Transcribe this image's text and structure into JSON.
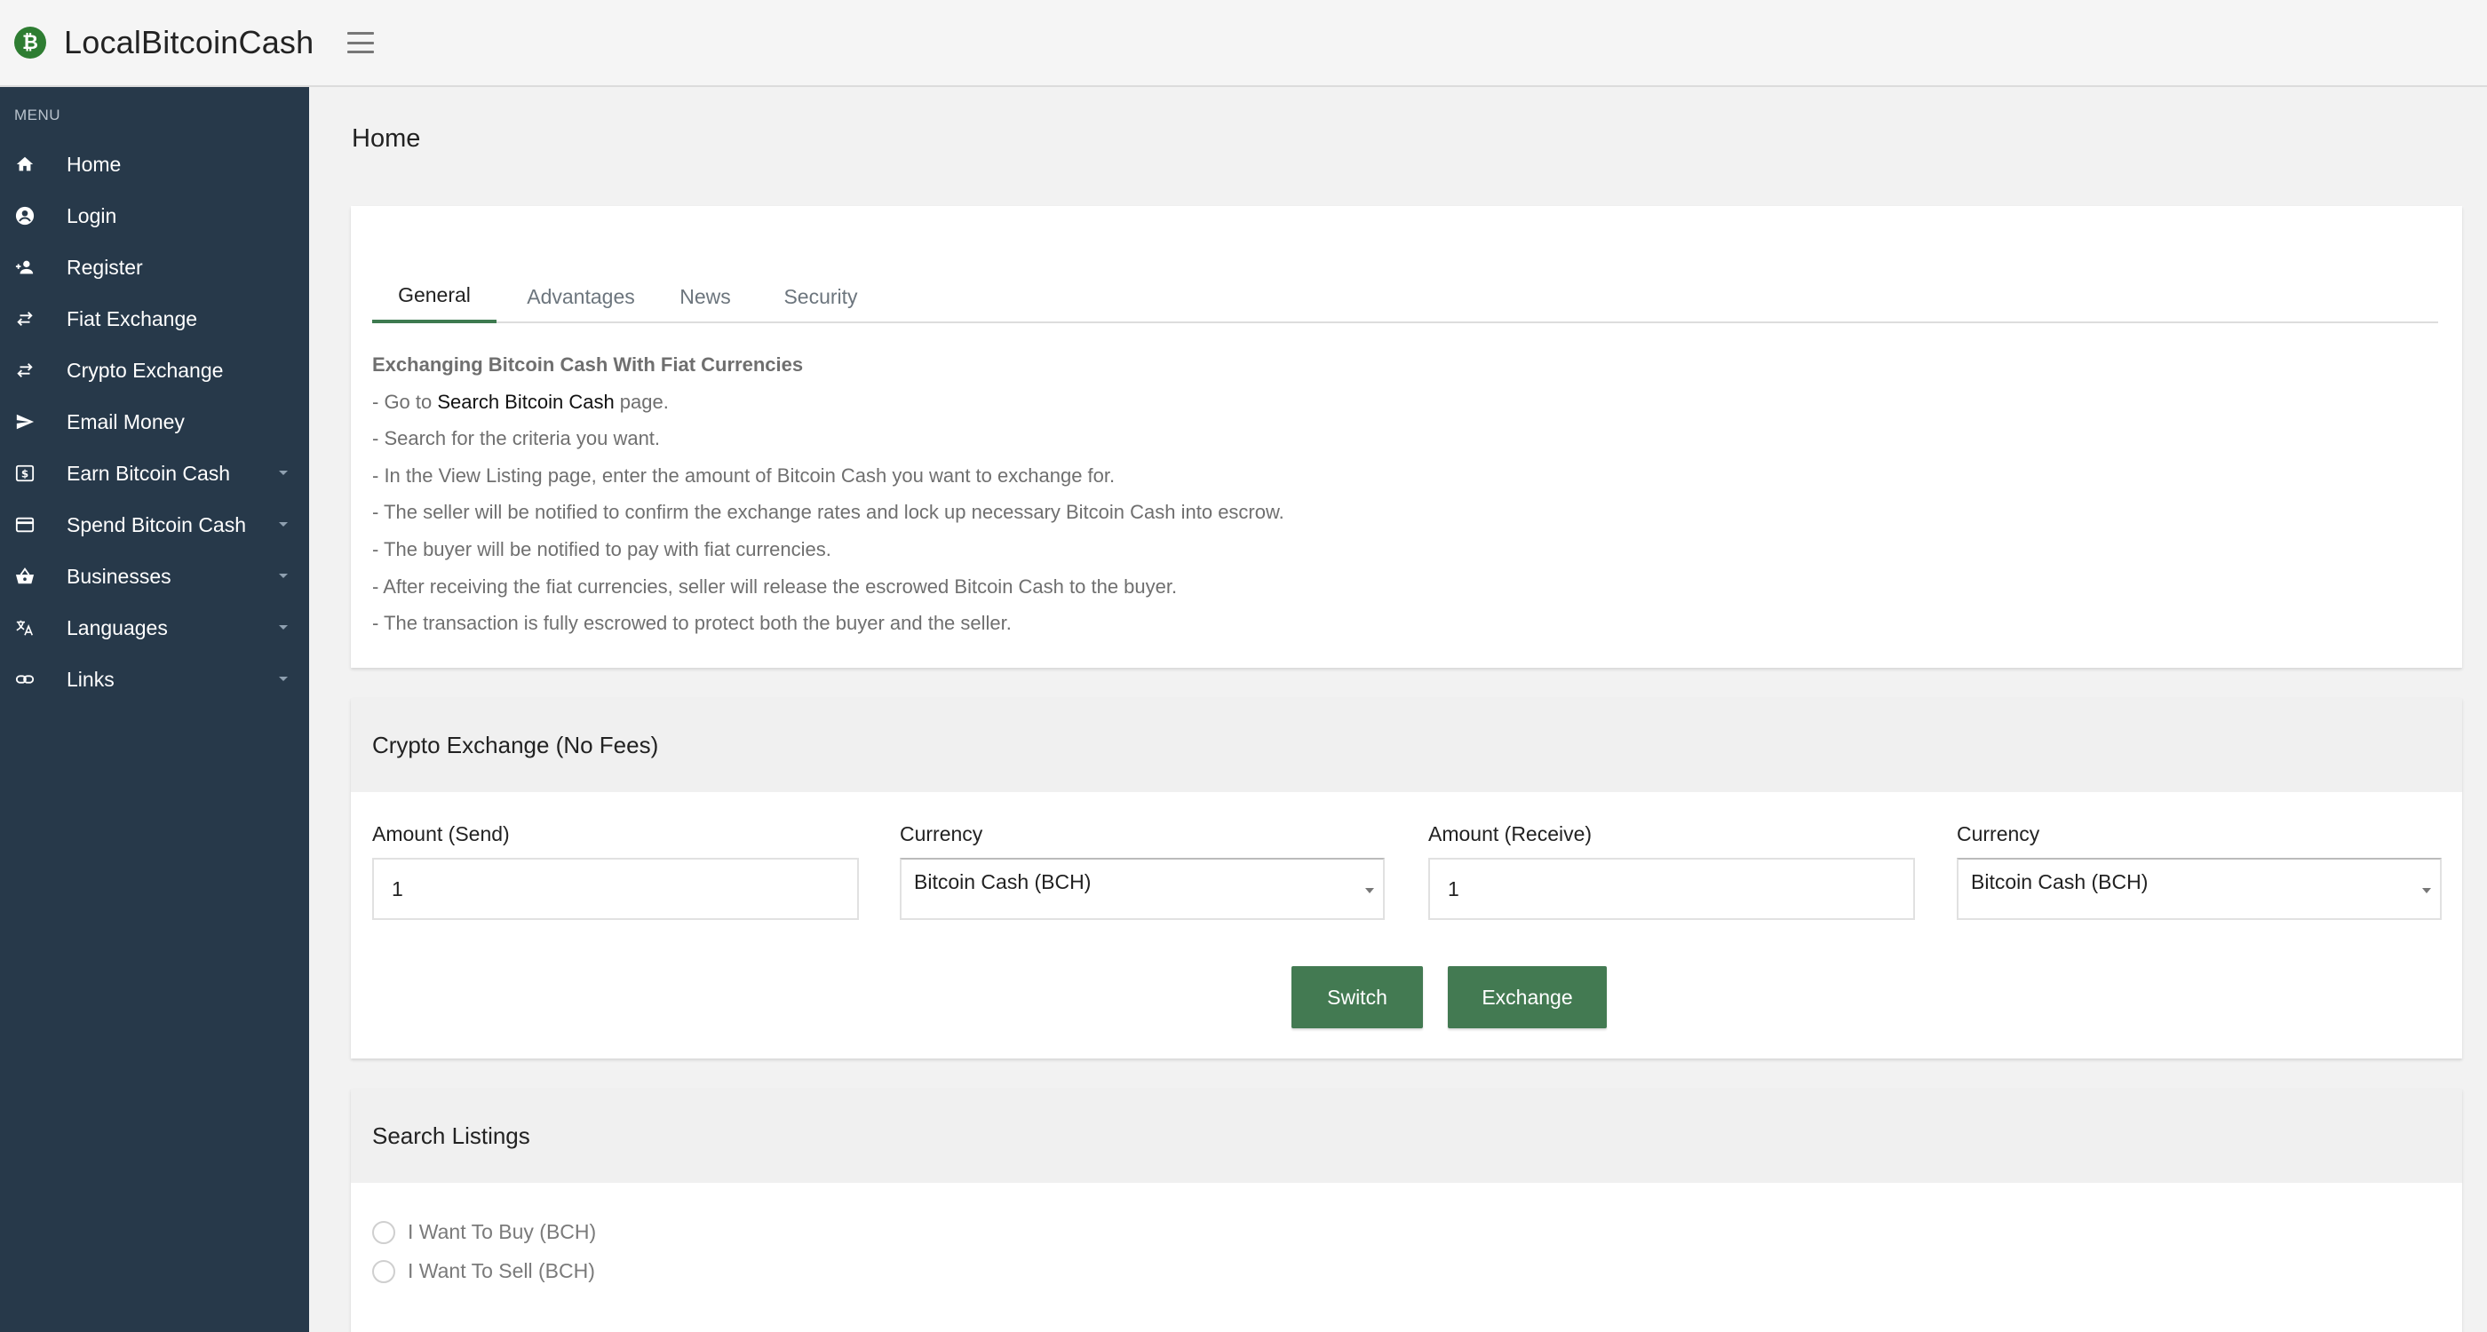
{
  "header": {
    "logo_glyph": "₿",
    "brand": "LocalBitcoinCash",
    "menu_icon": "hamburger-icon"
  },
  "sidebar": {
    "menu_header": "MENU",
    "items": [
      {
        "label": "Home",
        "icon": "home-icon",
        "has_submenu": false
      },
      {
        "label": "Login",
        "icon": "user-circle-icon",
        "has_submenu": false
      },
      {
        "label": "Register",
        "icon": "person-add-icon",
        "has_submenu": false
      },
      {
        "label": "Fiat Exchange",
        "icon": "swap-icon",
        "has_submenu": false
      },
      {
        "label": "Crypto Exchange",
        "icon": "swap-icon",
        "has_submenu": false
      },
      {
        "label": "Email Money",
        "icon": "send-icon",
        "has_submenu": false
      },
      {
        "label": "Earn Bitcoin Cash",
        "icon": "dollar-box-icon",
        "has_submenu": true
      },
      {
        "label": "Spend Bitcoin Cash",
        "icon": "credit-card-icon",
        "has_submenu": true
      },
      {
        "label": "Businesses",
        "icon": "basket-icon",
        "has_submenu": true
      },
      {
        "label": "Languages",
        "icon": "translate-icon",
        "has_submenu": true
      },
      {
        "label": "Links",
        "icon": "link-icon",
        "has_submenu": true
      }
    ]
  },
  "main": {
    "page_title": "Home",
    "tabs": [
      {
        "label": "General",
        "active": true
      },
      {
        "label": "Advantages",
        "active": false
      },
      {
        "label": "News",
        "active": false
      },
      {
        "label": "Security",
        "active": false
      }
    ],
    "general": {
      "heading": "Exchanging Bitcoin Cash With Fiat Currencies",
      "line1_prefix": "- Go to ",
      "line1_link": "Search Bitcoin Cash",
      "line1_suffix": " page.",
      "line2": "- Search for the criteria you want.",
      "line3": "- In the View Listing page, enter the amount of Bitcoin Cash you want to exchange for.",
      "line4": "- The seller will be notified to confirm the exchange rates and lock up necessary Bitcoin Cash into escrow.",
      "line5": "- The buyer will be notified to pay with fiat currencies.",
      "line6": "- After receiving the fiat currencies, seller will release the escrowed Bitcoin Cash to the buyer.",
      "line7": "- The transaction is fully escrowed to protect both the buyer and the seller."
    },
    "exchange": {
      "title": "Crypto Exchange (No Fees)",
      "amount_send_label": "Amount (Send)",
      "amount_send_value": "1",
      "currency_send_label": "Currency",
      "currency_send_value": "Bitcoin Cash (BCH)",
      "amount_receive_label": "Amount (Receive)",
      "amount_receive_value": "1",
      "currency_receive_label": "Currency",
      "currency_receive_value": "Bitcoin Cash (BCH)",
      "switch_label": "Switch",
      "exchange_label": "Exchange"
    },
    "search": {
      "title": "Search Listings",
      "option_buy": "I Want To Buy (BCH)",
      "option_sell": "I Want To Sell (BCH)"
    }
  },
  "colors": {
    "sidebar_bg": "#27394a",
    "accent_green": "#437a52",
    "logo_green": "#2e7d32"
  }
}
